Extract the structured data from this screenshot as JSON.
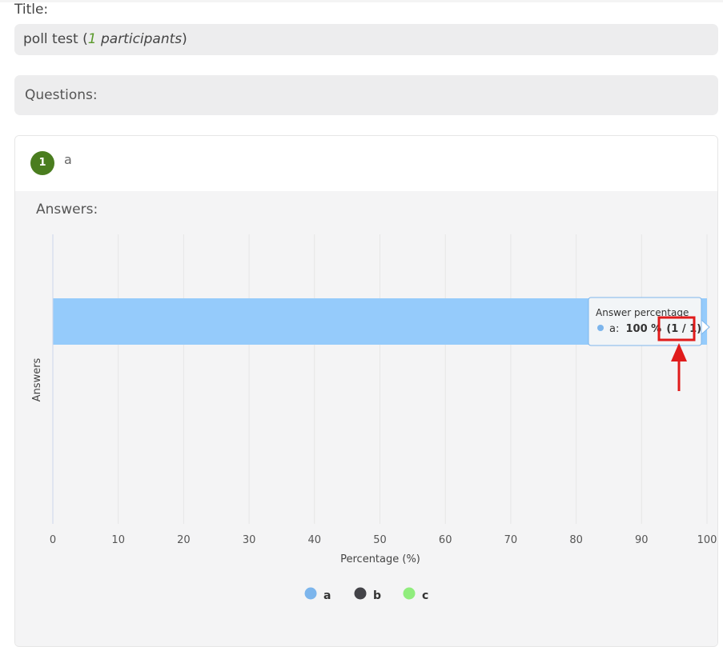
{
  "title_label": "Title:",
  "poll": {
    "name": "poll test",
    "open_paren": " (",
    "participant_count": "1",
    "participants_word": " participants",
    "close_paren": ")"
  },
  "questions_label": "Questions:",
  "question": {
    "number": "1",
    "text": "a"
  },
  "answers_label": "Answers:",
  "tooltip": {
    "title": "Answer percentage",
    "series": "a:",
    "value": "100 %",
    "fraction": "(1 / 1)"
  },
  "colors": {
    "accent_green": "#4a7d1f",
    "bar": "#95cbfb",
    "highlight": "#e01b1b"
  },
  "chart_data": {
    "type": "bar",
    "orientation": "horizontal",
    "categories": [
      "a"
    ],
    "series": [
      {
        "name": "a",
        "values": [
          100
        ],
        "color": "#7cb5ec"
      },
      {
        "name": "b",
        "values": [
          0
        ],
        "color": "#434348"
      },
      {
        "name": "c",
        "values": [
          0
        ],
        "color": "#90ed7d"
      }
    ],
    "xlabel": "Percentage (%)",
    "ylabel": "Answers",
    "xlim": [
      0,
      100
    ],
    "xticks": [
      "0",
      "10",
      "20",
      "30",
      "40",
      "50",
      "60",
      "70",
      "80",
      "90",
      "100"
    ],
    "grid": true,
    "legend": "bottom-center"
  }
}
